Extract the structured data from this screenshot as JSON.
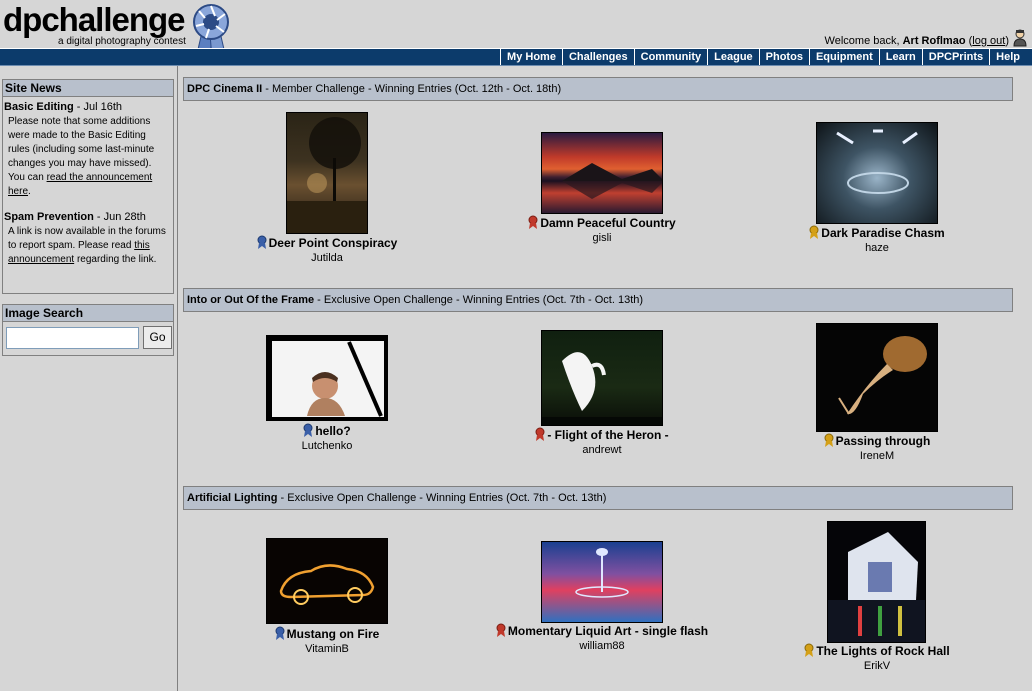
{
  "header": {
    "logo": "dpchallenge",
    "tagline": "a digital photography contest",
    "welcome_prefix": "Welcome back, ",
    "username": "Art Roflmao",
    "logout_open": " (",
    "logout_label": "log out",
    "logout_close": ")"
  },
  "nav": {
    "items": [
      "My Home",
      "Challenges",
      "Community",
      "League",
      "Photos",
      "Equipment",
      "Learn",
      "DPCPrints",
      "Help"
    ]
  },
  "sidebar": {
    "news_title": "Site News",
    "news": [
      {
        "headline": "Basic Editing",
        "date": " - Jul 16th",
        "body": "Please note that some additions were made to the Basic Editing rules (including some last-minute changes you may have missed). You can ",
        "link": "read the announcement here",
        "tail": "."
      },
      {
        "headline": "Spam Prevention",
        "date": " - Jun 28th",
        "body": "A link is now available in the forums to report spam. Please read ",
        "link": "this announcement",
        "tail": " regarding the link."
      }
    ],
    "search_title": "Image Search",
    "search_value": "",
    "go_label": "Go"
  },
  "challenges": [
    {
      "name": "DPC Cinema II",
      "desc": " - Member Challenge - Winning Entries (Oct. 12th - Oct. 18th)",
      "entries": [
        {
          "title": "Deer Point Conspiracy",
          "author": "Jutilda",
          "ribbon": "blue"
        },
        {
          "title": "Damn Peaceful Country",
          "author": "gisli",
          "ribbon": "red"
        },
        {
          "title": "Dark Paradise Chasm",
          "author": "haze",
          "ribbon": "yellow"
        }
      ]
    },
    {
      "name": "Into or Out Of the Frame",
      "desc": " - Exclusive Open Challenge - Winning Entries (Oct. 7th - Oct. 13th)",
      "entries": [
        {
          "title": "hello?",
          "author": "Lutchenko",
          "ribbon": "blue"
        },
        {
          "title": "- Flight of the Heron -",
          "author": "andrewt",
          "ribbon": "red"
        },
        {
          "title": "Passing through",
          "author": "IreneM",
          "ribbon": "yellow"
        }
      ]
    },
    {
      "name": "Artificial Lighting",
      "desc": " - Exclusive Open Challenge - Winning Entries (Oct. 7th - Oct. 13th)",
      "entries": [
        {
          "title": "Mustang on Fire",
          "author": "VitaminB",
          "ribbon": "blue"
        },
        {
          "title": "Momentary Liquid Art - single flash",
          "author": "william88",
          "ribbon": "red"
        },
        {
          "title": "The Lights of Rock Hall",
          "author": "ErikV",
          "ribbon": "yellow"
        }
      ]
    }
  ],
  "colors": {
    "nav_bg": "#0c3b6b",
    "bar_bg": "#b8c0cc",
    "ribbon_blue": "#3a5fa8",
    "ribbon_red": "#c0392b",
    "ribbon_yellow": "#d4a017"
  }
}
